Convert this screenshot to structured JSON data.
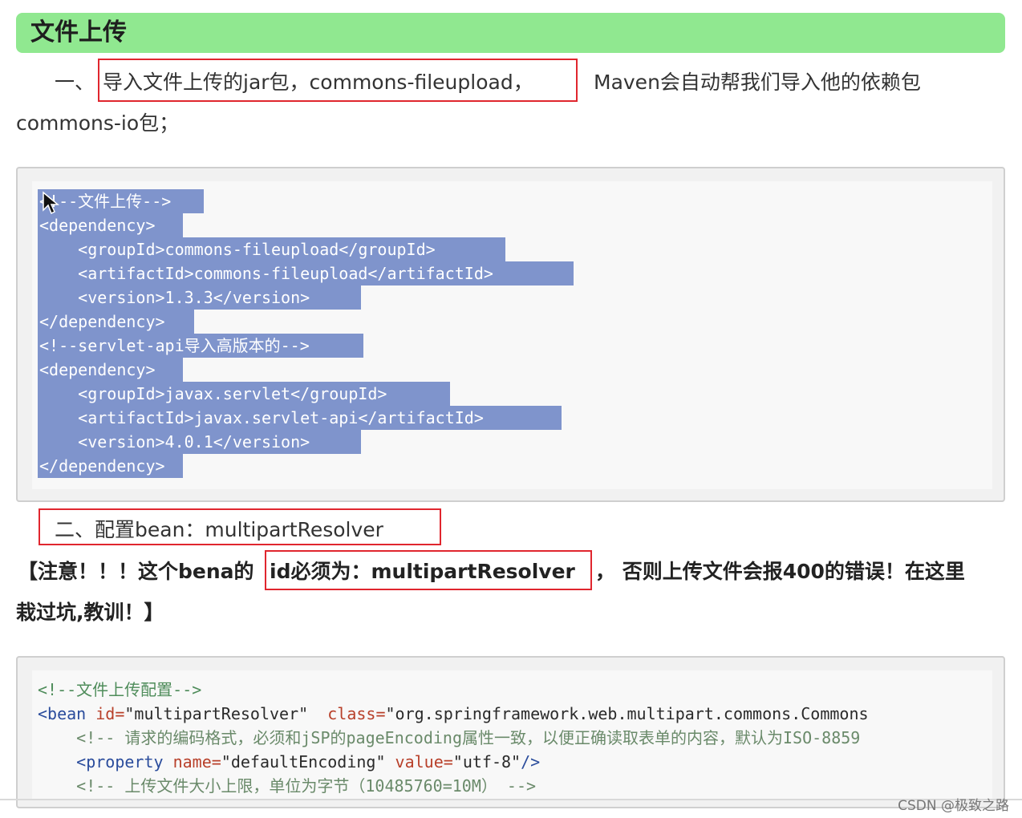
{
  "heading": "文件上传",
  "section1": {
    "prefix": "一、",
    "boxed": "导入文件上传的jar包，commons-fileupload，",
    "suffix": "Maven会自动帮我们导入他的依赖包",
    "line2": "commons-io包；"
  },
  "code1": {
    "lines": [
      "<!--文件上传-->",
      "<dependency>",
      "    <groupId>commons-fileupload</groupId>",
      "    <artifactId>commons-fileupload</artifactId>",
      "    <version>1.3.3</version>",
      "</dependency>",
      "<!--servlet-api导入高版本的-->",
      "<dependency>",
      "    <groupId>javax.servlet</groupId>",
      "    <artifactId>javax.servlet-api</artifactId>",
      "    <version>4.0.1</version>",
      "</dependency>"
    ]
  },
  "section2": {
    "title": "二、配置bean：multipartResolver"
  },
  "note": {
    "before": "【注意！！！这个bena的",
    "boxed": "id必须为：multipartResolver",
    "after": "，  否则上传文件会报400的错误！在这里",
    "line2": "栽过坑,教训！】"
  },
  "code2": {
    "line1": "<!--文件上传配置-->",
    "line2_tag": "<bean ",
    "line2_attr1": "id=",
    "line2_val1": "\"multipartResolver\"",
    "line2_attr2": "  class=",
    "line2_val2": "\"org.springframework.web.multipart.commons.Commons",
    "line3": "    <!-- 请求的编码格式，必须和jSP的pageEncoding属性一致，以便正确读取表单的内容，默认为ISO-8859",
    "line4_tag": "    <property ",
    "line4_attr1": "name=",
    "line4_val1": "\"defaultEncoding\"",
    "line4_attr2": " value=",
    "line4_val2": "\"utf-8\"",
    "line4_end": "/>",
    "line5": "    <!-- 上传文件大小上限，单位为字节（10485760=10M） -->"
  },
  "watermark": "CSDN @极致之路",
  "colors": {
    "heading_bg": "#90e890",
    "highlight_box": "#e0262e",
    "code_selection": "#7f94cc"
  },
  "icons": {
    "cursor": "mouse-pointer-icon"
  }
}
